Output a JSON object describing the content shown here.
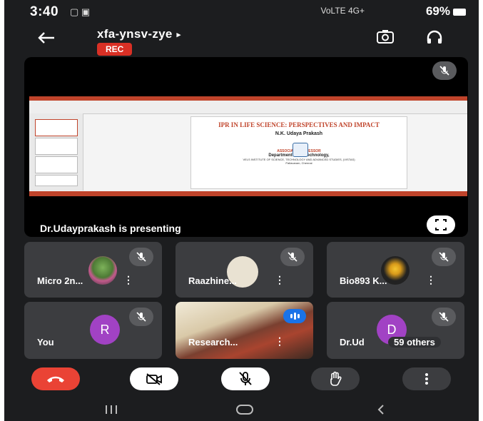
{
  "status_bar": {
    "time": "3:40",
    "network": "VoLTE 4G+",
    "battery": "69%"
  },
  "header": {
    "meeting_code": "xfa-ynsv-zye",
    "expand_glyph": "▸",
    "rec_label": "REC",
    "back_icon": "arrow-left",
    "switch_camera_icon": "camera-switch",
    "audio_output_icon": "headphones"
  },
  "presentation": {
    "presenting_label": "Dr.Udayprakash is presenting",
    "slide": {
      "title": "IPR IN LIFE SCIENCE: PERSPECTIVES AND IMPACT",
      "presenter_name": "N.K. Udaya Prakash",
      "role": "ASSOCIATE PROFESSOR",
      "department": "Department of Biotechnology,",
      "institute": "VELS INSTITUTE OF SCIENCE, TECHNOLOGY AND ADVANCED STUDIES, (VISTAS)",
      "location": "Pallavaram, Chennai"
    }
  },
  "participants": [
    {
      "name": "Micro 2n...",
      "type": "photo",
      "muted": true
    },
    {
      "name": "Raazhine...",
      "type": "photo",
      "muted": true
    },
    {
      "name": "Bio893 K...",
      "type": "photo",
      "muted": true
    },
    {
      "name": "You",
      "type": "letter",
      "letter": "R",
      "muted": true
    },
    {
      "name": "Research...",
      "type": "video",
      "muted": false
    },
    {
      "name": "Dr.Ud",
      "type": "letter",
      "letter": "D",
      "muted": true,
      "others_label": "59 others"
    }
  ],
  "controls": {
    "end_call_icon": "phone-hangup",
    "camera_icon": "camera-off",
    "mic_icon": "mic-off",
    "raise_hand_icon": "hand",
    "more_icon": "more-vertical"
  },
  "colors": {
    "background": "#1c1d1f",
    "tile": "#3c3d40",
    "rec_red": "#d93025",
    "end_call": "#ea4335",
    "avatar_purple": "#a142c4",
    "speaking_blue": "#1a73e8"
  }
}
